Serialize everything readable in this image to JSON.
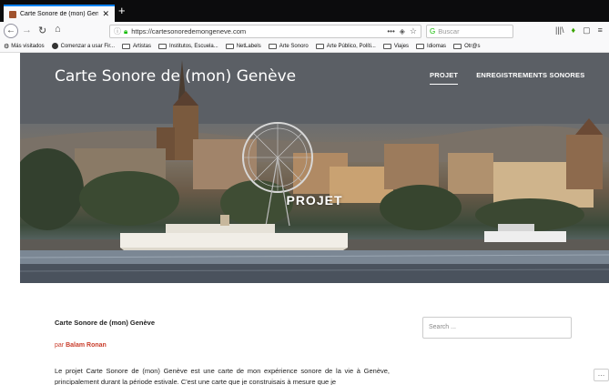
{
  "browser": {
    "tab_title": "Carte Sonore de (mon) Genève",
    "tab_close": "✕",
    "new_tab": "+",
    "url": "https://cartesonoredemongeneve.com",
    "search_placeholder": "Buscar",
    "bookmarks": [
      {
        "label": "Más visitados",
        "icon": "gear-icon"
      },
      {
        "label": "Comenzar a usar Fir...",
        "icon": "firefox-icon"
      },
      {
        "label": "Artistas",
        "icon": "folder-icon"
      },
      {
        "label": "Institutos, Escuela...",
        "icon": "folder-icon"
      },
      {
        "label": "NetLabels",
        "icon": "folder-icon"
      },
      {
        "label": "Arte Sonoro",
        "icon": "folder-icon"
      },
      {
        "label": "Arte Público, Políti...",
        "icon": "folder-icon"
      },
      {
        "label": "Viajes",
        "icon": "folder-icon"
      },
      {
        "label": "Idiomas",
        "icon": "folder-icon"
      },
      {
        "label": "Otr@s",
        "icon": "folder-icon"
      }
    ]
  },
  "site": {
    "title": "Carte Sonore de (mon) Genève",
    "menu": [
      "PROJET",
      "ENREGISTREMENTS SONORES"
    ],
    "hero_title": "PROJET"
  },
  "post": {
    "title": "Carte Sonore de (mon) Genève",
    "by": "par",
    "author": "Balam Ronan",
    "body": "Le projet Carte Sonore de (mon) Genève est une carte de mon expérience sonore de la vie à Genève, principalement durant la période estivale. C'est une carte que je construisais à mesure que je"
  },
  "sidebar": {
    "search_placeholder": "Search ..."
  },
  "more_button": "…"
}
